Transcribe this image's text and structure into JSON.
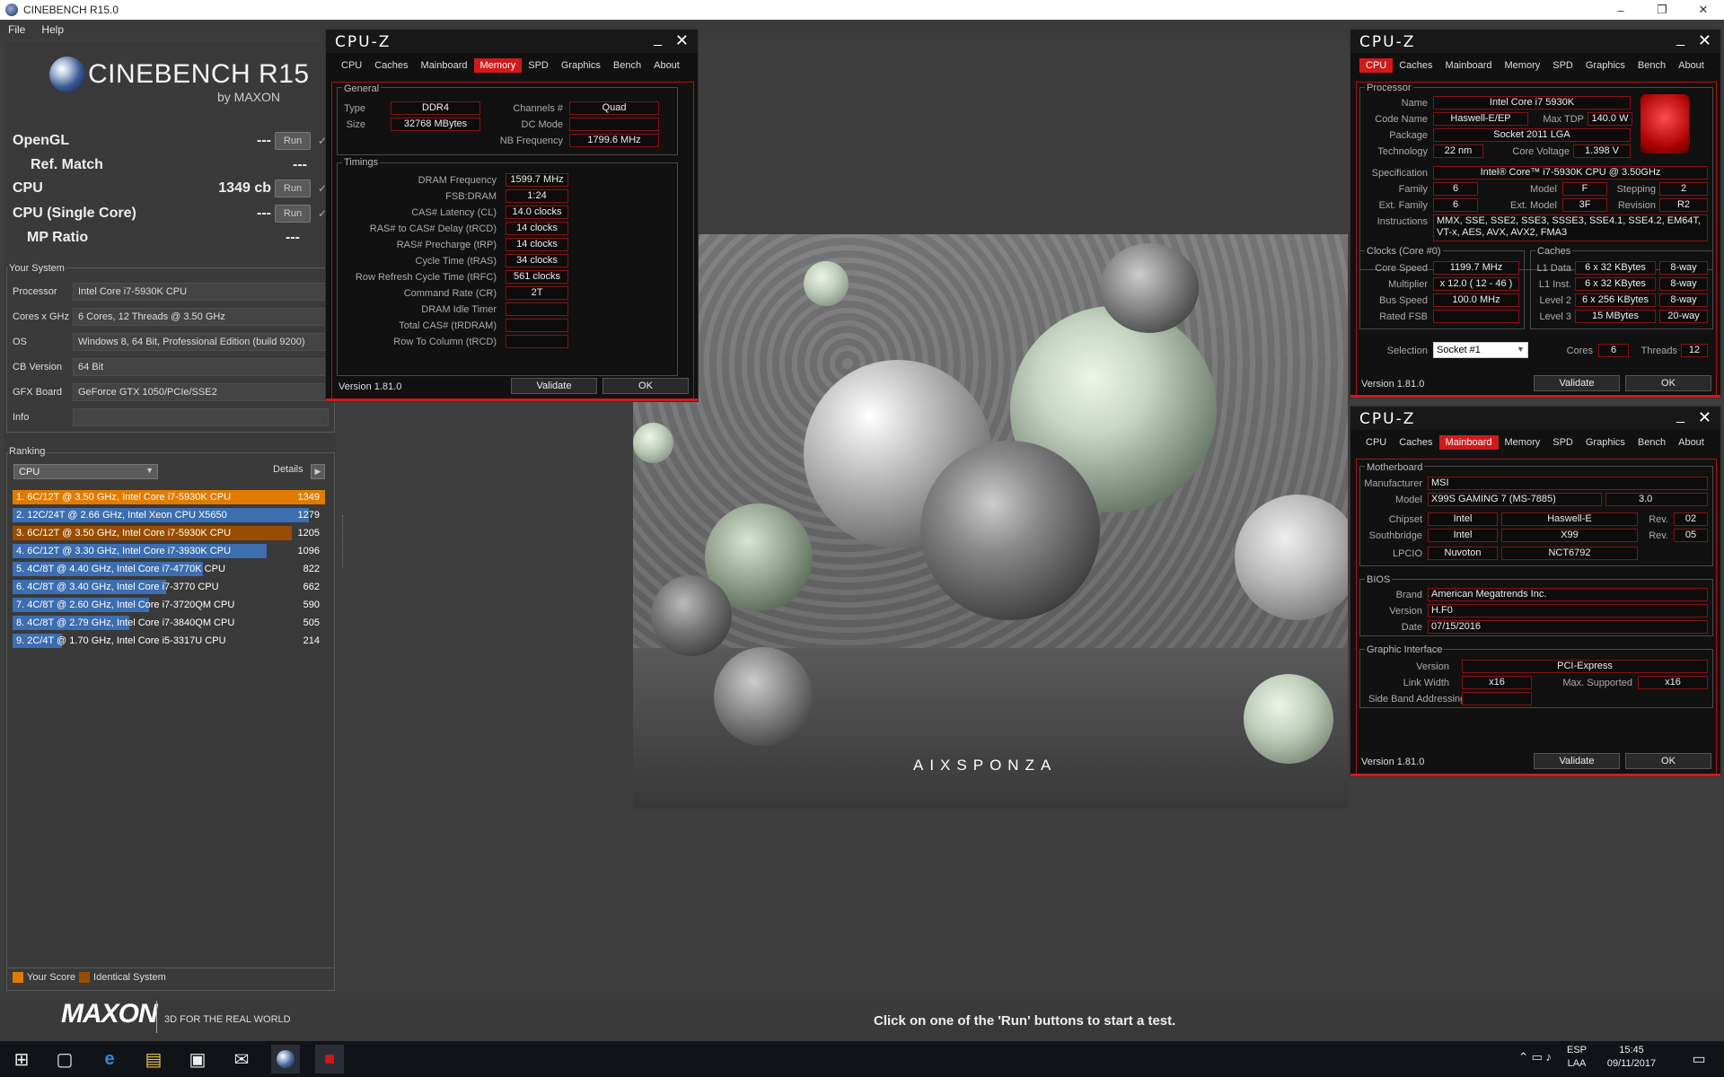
{
  "window": {
    "title": "CINEBENCH R15.0"
  },
  "menu": [
    "File",
    "Help"
  ],
  "logo": {
    "name": "CINEBENCH R15",
    "by": "by MAXON"
  },
  "tests": [
    {
      "label": "OpenGL",
      "value": "---",
      "run": "Run",
      "check": "✓"
    },
    {
      "label": "Ref. Match",
      "value": "---"
    },
    {
      "label": "CPU",
      "value": "1349 cb",
      "run": "Run",
      "check": "✓"
    },
    {
      "label": "CPU (Single Core)",
      "value": "---",
      "run": "Run",
      "check": "✓"
    },
    {
      "label": "MP Ratio",
      "value": "---"
    }
  ],
  "system": {
    "header": "Your System",
    "rows": [
      {
        "k": "Processor",
        "v": "Intel Core i7-5930K CPU"
      },
      {
        "k": "Cores x GHz",
        "v": "6 Cores, 12 Threads @ 3.50 GHz"
      },
      {
        "k": "OS",
        "v": "Windows 8, 64 Bit, Professional Edition (build 9200)"
      },
      {
        "k": "CB Version",
        "v": "64 Bit"
      },
      {
        "k": "GFX Board",
        "v": "GeForce GTX 1050/PCIe/SSE2"
      },
      {
        "k": "Info",
        "v": ""
      }
    ]
  },
  "ranking": {
    "header": "Ranking",
    "select": "CPU",
    "details": "Details",
    "max": 1349,
    "rows": [
      {
        "text": "1. 6C/12T @ 3.50 GHz, Intel Core i7-5930K CPU",
        "score": 1349,
        "kind": "your"
      },
      {
        "text": "2. 12C/24T @ 2.66 GHz, Intel Xeon CPU X5650",
        "score": 1279,
        "kind": "other"
      },
      {
        "text": "3. 6C/12T @ 3.50 GHz, Intel Core i7-5930K CPU",
        "score": 1205,
        "kind": "identical"
      },
      {
        "text": "4. 6C/12T @ 3.30 GHz,  Intel Core i7-3930K CPU",
        "score": 1096,
        "kind": "other"
      },
      {
        "text": "5. 4C/8T @ 4.40 GHz, Intel Core i7-4770K CPU",
        "score": 822,
        "kind": "other"
      },
      {
        "text": "6. 4C/8T @ 3.40 GHz,  Intel Core i7-3770 CPU",
        "score": 662,
        "kind": "other"
      },
      {
        "text": "7. 4C/8T @ 2.60 GHz, Intel Core i7-3720QM CPU",
        "score": 590,
        "kind": "other"
      },
      {
        "text": "8. 4C/8T @ 2.79 GHz,  Intel Core i7-3840QM CPU",
        "score": 505,
        "kind": "other"
      },
      {
        "text": "9. 2C/4T @ 1.70 GHz,  Intel Core i5-3317U CPU",
        "score": 214,
        "kind": "other"
      }
    ],
    "legend": {
      "your": "Your Score",
      "identical": "Identical System"
    }
  },
  "colors": {
    "your": "#e07b00",
    "identical": "#9a4d00",
    "other": "#3c6eb0",
    "cpuz_red": "#d01a1a"
  },
  "bottom": {
    "maxon": "MAXON",
    "tagline": "3D FOR THE REAL WORLD",
    "status": "Click on one of the 'Run' buttons to start a test."
  },
  "render": {
    "brand": "AIXSPONZA"
  },
  "cpuz_common": {
    "title": "CPU-Z",
    "tabs": [
      "CPU",
      "Caches",
      "Mainboard",
      "Memory",
      "SPD",
      "Graphics",
      "Bench",
      "About"
    ],
    "version": "Version 1.81.0",
    "validate": "Validate",
    "ok": "OK",
    "minimize": "_",
    "close": "✕"
  },
  "cpuz_memory": {
    "active_tab": "Memory",
    "general": "General",
    "type_label": "Type",
    "type": "DDR4",
    "size_label": "Size",
    "size": "32768 MBytes",
    "channels_label": "Channels #",
    "channels": "Quad",
    "dc_label": "DC Mode",
    "dc": "",
    "nb_label": "NB Frequency",
    "nb": "1799.6 MHz",
    "timings": "Timings",
    "rows": [
      {
        "k": "DRAM Frequency",
        "v": "1599.7 MHz"
      },
      {
        "k": "FSB:DRAM",
        "v": "1:24"
      },
      {
        "k": "CAS# Latency (CL)",
        "v": "14.0 clocks"
      },
      {
        "k": "RAS# to CAS# Delay (tRCD)",
        "v": "14 clocks"
      },
      {
        "k": "RAS# Precharge (tRP)",
        "v": "14 clocks"
      },
      {
        "k": "Cycle Time (tRAS)",
        "v": "34 clocks"
      },
      {
        "k": "Row Refresh Cycle Time (tRFC)",
        "v": "561 clocks"
      },
      {
        "k": "Command Rate (CR)",
        "v": "2T"
      },
      {
        "k": "DRAM Idle Timer",
        "v": ""
      },
      {
        "k": "Total CAS# (tRDRAM)",
        "v": ""
      },
      {
        "k": "Row To Column (tRCD)",
        "v": ""
      }
    ]
  },
  "cpuz_cpu": {
    "active_tab": "CPU",
    "processor": "Processor",
    "name_l": "Name",
    "name": "Intel Core i7 5930K",
    "code_l": "Code Name",
    "code": "Haswell-E/EP",
    "tdp_l": "Max TDP",
    "tdp": "140.0 W",
    "pkg_l": "Package",
    "pkg": "Socket 2011 LGA",
    "tech_l": "Technology",
    "tech": "22 nm",
    "volt_l": "Core Voltage",
    "volt": "1.398 V",
    "spec_l": "Specification",
    "spec": "Intel® Core™ i7-5930K CPU @ 3.50GHz",
    "family_l": "Family",
    "family": "6",
    "model_l": "Model",
    "model": "F",
    "step_l": "Stepping",
    "step": "2",
    "extfam_l": "Ext. Family",
    "extfam": "6",
    "extmod_l": "Ext. Model",
    "extmod": "3F",
    "rev_l": "Revision",
    "rev": "R2",
    "instr_l": "Instructions",
    "instr": "MMX, SSE, SSE2, SSE3, SSSE3, SSE4.1, SSE4.2, EM64T, VT-x, AES, AVX, AVX2, FMA3",
    "clocks": "Clocks (Core #0)",
    "speed_l": "Core Speed",
    "speed": "1199.7 MHz",
    "mult_l": "Multiplier",
    "mult": "x 12.0 ( 12 - 46 )",
    "bus_l": "Bus Speed",
    "bus": "100.0 MHz",
    "fsb_l": "Rated FSB",
    "fsb": "",
    "caches": "Caches",
    "l1d_l": "L1 Data",
    "l1d": "6 x 32 KBytes",
    "l1d_w": "8-way",
    "l1i_l": "L1 Inst.",
    "l1i": "6 x 32 KBytes",
    "l1i_w": "8-way",
    "l2_l": "Level 2",
    "l2": "6 x 256 KBytes",
    "l2_w": "8-way",
    "l3_l": "Level 3",
    "l3": "15 MBytes",
    "l3_w": "20-way",
    "sel_l": "Selection",
    "sel": "Socket #1",
    "cores_l": "Cores",
    "cores": "6",
    "threads_l": "Threads",
    "threads": "12"
  },
  "cpuz_mb": {
    "active_tab": "Mainboard",
    "motherboard": "Motherboard",
    "mfr_l": "Manufacturer",
    "mfr": "MSI",
    "model_l": "Model",
    "model": "X99S GAMING 7 (MS-7885)",
    "model_rev": "3.0",
    "chip_l": "Chipset",
    "chip": "Intel",
    "chip2": "Haswell-E",
    "chip_rev_l": "Rev.",
    "chip_rev": "02",
    "sb_l": "Southbridge",
    "sb": "Intel",
    "sb2": "X99",
    "sb_rev_l": "Rev.",
    "sb_rev": "05",
    "lpcio_l": "LPCIO",
    "lpcio": "Nuvoton",
    "lpcio2": "NCT6792",
    "bios": "BIOS",
    "brand_l": "Brand",
    "brand": "American Megatrends Inc.",
    "version_l": "Version",
    "version": "H.F0",
    "date_l": "Date",
    "date": "07/15/2016",
    "gi": "Graphic Interface",
    "gver_l": "Version",
    "gver": "PCI-Express",
    "lw_l": "Link Width",
    "lw": "x16",
    "ms_l": "Max. Supported",
    "ms": "x16",
    "sba_l": "Side Band Addressing",
    "sba": ""
  },
  "tray": {
    "lang1": "ESP",
    "lang2": "LAA",
    "time": "15:45",
    "date": "09/11/2017"
  }
}
